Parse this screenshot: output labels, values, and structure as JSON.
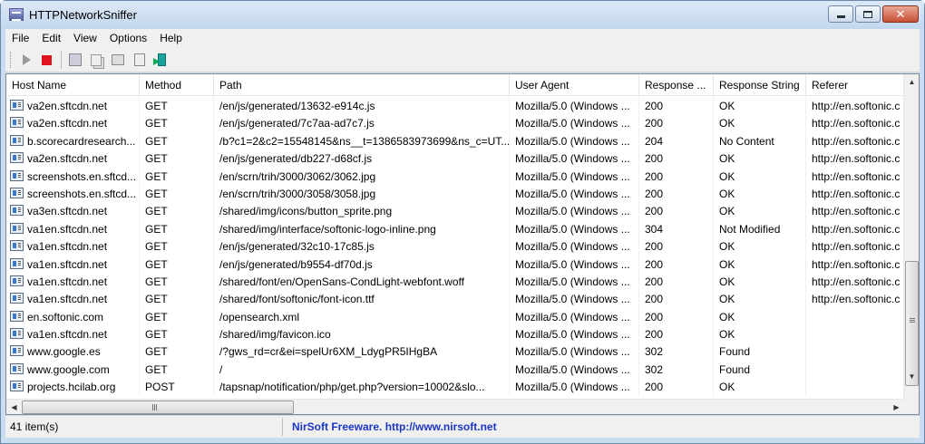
{
  "window": {
    "title": "HTTPNetworkSniffer"
  },
  "menu": [
    "File",
    "Edit",
    "View",
    "Options",
    "Help"
  ],
  "toolbar": {
    "buttons": [
      "play-icon",
      "stop-icon",
      "save-icon",
      "copy-icon",
      "properties-icon",
      "find-icon",
      "exit-icon"
    ]
  },
  "columns": [
    "Host Name",
    "Method",
    "Path",
    "User Agent",
    "Response ...",
    "Response String",
    "Referer"
  ],
  "rows": [
    [
      "va2en.sftcdn.net",
      "GET",
      "/en/js/generated/13632-e914c.js",
      "Mozilla/5.0 (Windows ...",
      "200",
      "OK",
      "http://en.softonic.c"
    ],
    [
      "va2en.sftcdn.net",
      "GET",
      "/en/js/generated/7c7aa-ad7c7.js",
      "Mozilla/5.0 (Windows ...",
      "200",
      "OK",
      "http://en.softonic.c"
    ],
    [
      "b.scorecardresearch...",
      "GET",
      "/b?c1=2&c2=15548145&ns__t=1386583973699&ns_c=UT...",
      "Mozilla/5.0 (Windows ...",
      "204",
      "No Content",
      "http://en.softonic.c"
    ],
    [
      "va2en.sftcdn.net",
      "GET",
      "/en/js/generated/db227-d68cf.js",
      "Mozilla/5.0 (Windows ...",
      "200",
      "OK",
      "http://en.softonic.c"
    ],
    [
      "screenshots.en.sftcd...",
      "GET",
      "/en/scrn/trih/3000/3062/3062.jpg",
      "Mozilla/5.0 (Windows ...",
      "200",
      "OK",
      "http://en.softonic.c"
    ],
    [
      "screenshots.en.sftcd...",
      "GET",
      "/en/scrn/trih/3000/3058/3058.jpg",
      "Mozilla/5.0 (Windows ...",
      "200",
      "OK",
      "http://en.softonic.c"
    ],
    [
      "va3en.sftcdn.net",
      "GET",
      "/shared/img/icons/button_sprite.png",
      "Mozilla/5.0 (Windows ...",
      "200",
      "OK",
      "http://en.softonic.c"
    ],
    [
      "va1en.sftcdn.net",
      "GET",
      "/shared/img/interface/softonic-logo-inline.png",
      "Mozilla/5.0 (Windows ...",
      "304",
      "Not Modified",
      "http://en.softonic.c"
    ],
    [
      "va1en.sftcdn.net",
      "GET",
      "/en/js/generated/32c10-17c85.js",
      "Mozilla/5.0 (Windows ...",
      "200",
      "OK",
      "http://en.softonic.c"
    ],
    [
      "va1en.sftcdn.net",
      "GET",
      "/en/js/generated/b9554-df70d.js",
      "Mozilla/5.0 (Windows ...",
      "200",
      "OK",
      "http://en.softonic.c"
    ],
    [
      "va1en.sftcdn.net",
      "GET",
      "/shared/font/en/OpenSans-CondLight-webfont.woff",
      "Mozilla/5.0 (Windows ...",
      "200",
      "OK",
      "http://en.softonic.c"
    ],
    [
      "va1en.sftcdn.net",
      "GET",
      "/shared/font/softonic/font-icon.ttf",
      "Mozilla/5.0 (Windows ...",
      "200",
      "OK",
      "http://en.softonic.c"
    ],
    [
      "en.softonic.com",
      "GET",
      "/opensearch.xml",
      "Mozilla/5.0 (Windows ...",
      "200",
      "OK",
      ""
    ],
    [
      "va1en.sftcdn.net",
      "GET",
      "/shared/img/favicon.ico",
      "Mozilla/5.0 (Windows ...",
      "200",
      "OK",
      ""
    ],
    [
      "www.google.es",
      "GET",
      "/?gws_rd=cr&ei=spelUr6XM_LdygPR5IHgBA",
      "Mozilla/5.0 (Windows ...",
      "302",
      "Found",
      ""
    ],
    [
      "www.google.com",
      "GET",
      "/",
      "Mozilla/5.0 (Windows ...",
      "302",
      "Found",
      ""
    ],
    [
      "projects.hcilab.org",
      "POST",
      "/tapsnap/notification/php/get.php?version=10002&slo...",
      "Mozilla/5.0 (Windows ...",
      "200",
      "OK",
      ""
    ]
  ],
  "status": {
    "count": "41 item(s)",
    "link": "NirSoft Freeware.  http://www.nirsoft.net"
  }
}
